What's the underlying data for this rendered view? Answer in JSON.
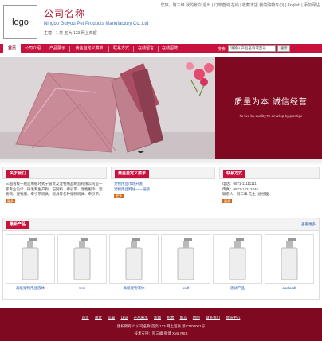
{
  "header": {
    "logo": "logo",
    "company_cn": "公司名称",
    "company_en": "Ningbo Guiyou Pet Products Manufactory Co.,Ltd",
    "sub": "主营：1 类 五大 123 网上商超",
    "toplinks": "您好，阿三峰 我的帐户 退出 | 订单查询 在线 | 收藏本店 我的购物车(0) | English | 添加网站"
  },
  "nav": {
    "items": [
      "首页",
      "公司介绍",
      "产品展示",
      "黄金自定义菜单",
      "联系方式",
      "在线留言",
      "在线招聘"
    ],
    "search_label": "搜索:",
    "search_placeholder": "请输入产品名称或型号",
    "search_button": "搜索"
  },
  "banner": {
    "headline": "质量为本 诚信经营",
    "slogan": "To live by quality,To develop by prestige"
  },
  "about": {
    "title": "关于我们",
    "text": "三国看板一般是用循环式宁波贵友宠物用品制造有限公司是一家专业设计、研发和生产狗、猫饲料、牵引带、宠物服饰、宠物窝、宠物服、牵引带玩具、玩具等各种宠物玩具、牵引带。",
    "more": "更多"
  },
  "custom": {
    "title": "黄金自定义菜单",
    "links": [
      "宠物用品市场开发",
      "宠物用品网站——链接"
    ],
    "more": "更多"
  },
  "contact": {
    "title": "联系方式",
    "lines": [
      "电话：0571-11111111",
      "传真：0571-12313245",
      "联系人：阿三峰 先生 (总经理)"
    ],
    "more": "更多"
  },
  "products": {
    "title": "最新产品",
    "more": "查看更多",
    "items": [
      "高级宠物用品液体",
      "test",
      "高级宠物液体",
      "asdf",
      "测试产品",
      "asdfasdf"
    ]
  },
  "footer": {
    "links": [
      "首页",
      "简介",
      "信誉",
      "认证",
      "产品展示",
      "新闻",
      "招聘",
      "留言",
      "地图",
      "联系我们",
      "会员中心"
    ],
    "line1": "版权所有 © 公司名称  首页  123  网上超商  浙ICP00001号",
    "line2": "技术支持：阿三峰  微博  XML  RSS"
  },
  "colors": {
    "primary": "#c8123e",
    "dark": "#7e0920"
  }
}
